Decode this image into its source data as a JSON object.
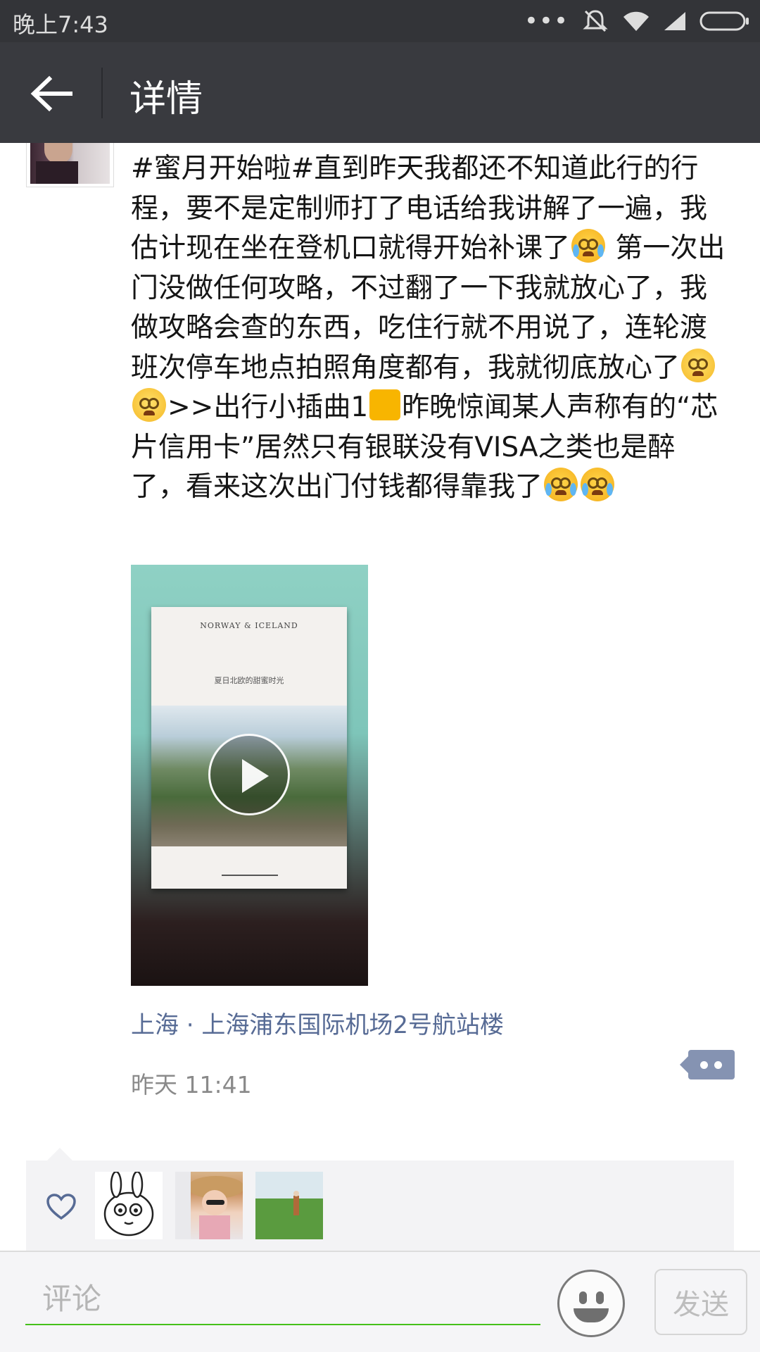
{
  "status_bar": {
    "time": "晚上7:43",
    "overflow_indicator": "•••",
    "icons": [
      "overflow-dots-icon",
      "mute-icon",
      "wifi-icon",
      "signal-icon",
      "battery-icon"
    ]
  },
  "nav": {
    "title": "详情",
    "back_icon": "arrow-left-icon"
  },
  "post": {
    "text_parts": {
      "p1": "#蜜月开始啦#直到昨天我都还不知道此行的行程，要不是定制师打了电话给我讲解了一遍，我估计现在坐在登机口就得开始补课了",
      "p2": " 第一次出门没做任何攻略，不过翻了一下我就放心了，我做攻略会查的东西，吃住行就不用说了，连轮渡班次停车地点拍照角度都有，我就彻底放心了",
      "p3": ">>出行小插曲1",
      "p4": "昨晚惊闻某人声称有的“芯片信用卡”居然只有银联没有VISA之类也是醉了，看来这次出门付钱都得靠我了"
    },
    "emojis": [
      "cry-emoji",
      "dizzy-emoji",
      "dizzy-emoji",
      "square-emoji",
      "cry-emoji",
      "cry-emoji"
    ],
    "video": {
      "book_title": "NORWAY & ICELAND",
      "book_subtitle": "夏日北欧的甜蜜时光",
      "play_icon": "play-icon"
    },
    "location": "上海 · 上海浦东国际机场2号航站楼",
    "time": "昨天 11:41"
  },
  "likes": {
    "icon": "heart-icon",
    "avatars": [
      "avatar-cartoon-rabbit",
      "avatar-woman-hat",
      "avatar-field-landscape"
    ]
  },
  "composer": {
    "placeholder": "评论",
    "value": "",
    "send_label": "发送",
    "emoji_icon": "smiley-icon"
  },
  "colors": {
    "nav_bg": "#393a3f",
    "status_bg": "#333438",
    "link": "#576b95",
    "input_underline": "#45c01a",
    "comment_btn": "#8593b2"
  }
}
